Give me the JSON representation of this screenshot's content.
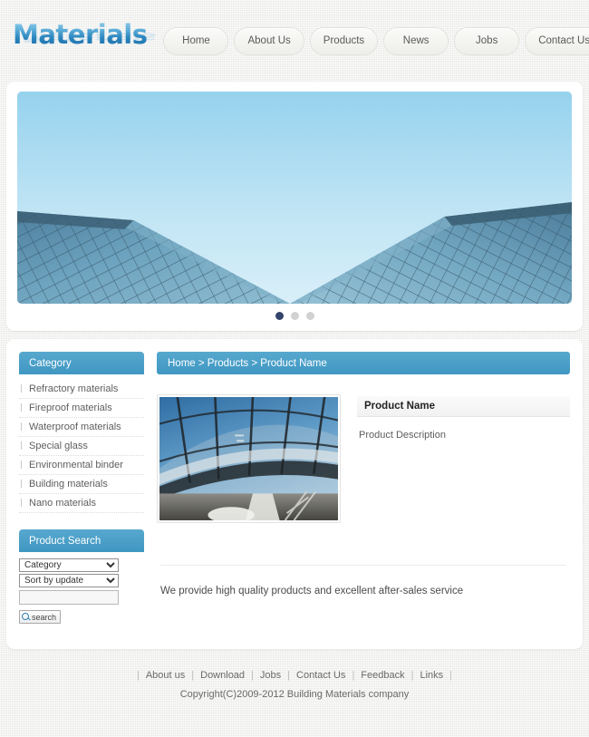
{
  "header": {
    "logo_text": "Materials",
    "nav": [
      {
        "label": "Home"
      },
      {
        "label": "About Us"
      },
      {
        "label": "Products"
      },
      {
        "label": "News"
      },
      {
        "label": "Jobs"
      },
      {
        "label": "Contact Us"
      }
    ]
  },
  "banner": {
    "alt": "glass-office-towers-against-blue-sky",
    "slides": [
      {
        "active": true
      },
      {
        "active": false
      },
      {
        "active": false
      }
    ]
  },
  "sidebar": {
    "category": {
      "title": "Category",
      "items": [
        {
          "label": "Refractory materials"
        },
        {
          "label": "Fireproof materials"
        },
        {
          "label": "Waterproof materials"
        },
        {
          "label": "Special glass"
        },
        {
          "label": "Environmental binder"
        },
        {
          "label": "Building materials"
        },
        {
          "label": "Nano materials"
        }
      ]
    },
    "product_search": {
      "title": "Product Search",
      "category_select": {
        "value": "Category",
        "options": [
          "Category"
        ]
      },
      "sort_select": {
        "value": "Sort by update",
        "options": [
          "Sort by update"
        ]
      },
      "keyword_input": {
        "value": "",
        "placeholder": ""
      },
      "search_button": {
        "label": "search",
        "icon": "magnifier-icon"
      }
    }
  },
  "main": {
    "breadcrumb": "Home > Products > Product Name",
    "product": {
      "image_alt": "curved-glass-atrium-canopy-interior",
      "name": "Product Name",
      "description": "Product Description"
    },
    "tagline": "We provide high quality products and excellent after-sales service"
  },
  "footer": {
    "links": [
      {
        "label": "About us"
      },
      {
        "label": "Download"
      },
      {
        "label": "Jobs"
      },
      {
        "label": "Contact Us"
      },
      {
        "label": "Feedback"
      },
      {
        "label": "Links"
      }
    ],
    "separator": "|",
    "copyright": "Copyright(C)2009-2012 Building Materials company"
  },
  "colors": {
    "accent_blue": "#3f97c2",
    "accent_blue_light": "#57a8ce",
    "logo_blue": "#2a84bd",
    "dot_active": "#33436b",
    "page_bg": "#eeeeec"
  }
}
